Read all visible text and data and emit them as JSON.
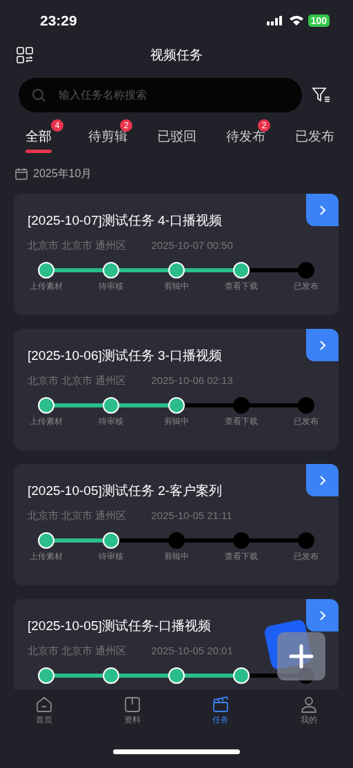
{
  "status_bar": {
    "time": "23:29",
    "battery": "100"
  },
  "header": {
    "title": "视频任务"
  },
  "search": {
    "placeholder": "输入任务名称搜索"
  },
  "tabs": [
    {
      "label": "全部",
      "badge": "4",
      "selected": true
    },
    {
      "label": "待剪辑",
      "badge": "2",
      "selected": false
    },
    {
      "label": "已驳回",
      "selected": false
    },
    {
      "label": "待发布",
      "badge": "2",
      "selected": false
    },
    {
      "label": "已发布",
      "selected": false
    }
  ],
  "month": "2025年10月",
  "tasks": [
    {
      "title": "[2025-10-07]测试任务 4-口播视频",
      "location": "北京市 北京市 通州区",
      "time": "2025-10-07 00:50",
      "steps": [
        {
          "label": "上传素材",
          "done": true
        },
        {
          "label": "待审核",
          "done": true
        },
        {
          "label": "剪辑中",
          "done": true
        },
        {
          "label": "查看下载",
          "done": true
        },
        {
          "label": "已发布",
          "done": false
        }
      ]
    },
    {
      "title": "[2025-10-06]测试任务 3-口播视频",
      "location": "北京市 北京市 通州区",
      "time": "2025-10-06 02:13",
      "steps": [
        {
          "label": "上传素材",
          "done": true
        },
        {
          "label": "待审核",
          "done": true
        },
        {
          "label": "剪辑中",
          "done": true
        },
        {
          "label": "查看下载",
          "done": false
        },
        {
          "label": "已发布",
          "done": false
        }
      ]
    },
    {
      "title": "[2025-10-05]测试任务 2-客户案列",
      "location": "北京市 北京市 通州区",
      "time": "2025-10-05 21:11",
      "steps": [
        {
          "label": "上传素材",
          "done": true
        },
        {
          "label": "待审核",
          "done": true
        },
        {
          "label": "剪辑中",
          "done": false
        },
        {
          "label": "查看下载",
          "done": false
        },
        {
          "label": "已发布",
          "done": false
        }
      ]
    },
    {
      "title": "[2025-10-05]测试任务-口播视频",
      "location": "北京市 北京市 通州区",
      "time": "2025-10-05 20:01",
      "steps": [
        {
          "done": true
        },
        {
          "done": true
        },
        {
          "done": true
        },
        {
          "done": true
        },
        {
          "done": false
        }
      ]
    }
  ],
  "nav": [
    {
      "label": "首页",
      "kind": "home",
      "selected": false
    },
    {
      "label": "资料",
      "kind": "book",
      "selected": false
    },
    {
      "label": "任务",
      "kind": "clapper",
      "selected": true
    },
    {
      "label": "我的",
      "kind": "person",
      "selected": false
    }
  ]
}
